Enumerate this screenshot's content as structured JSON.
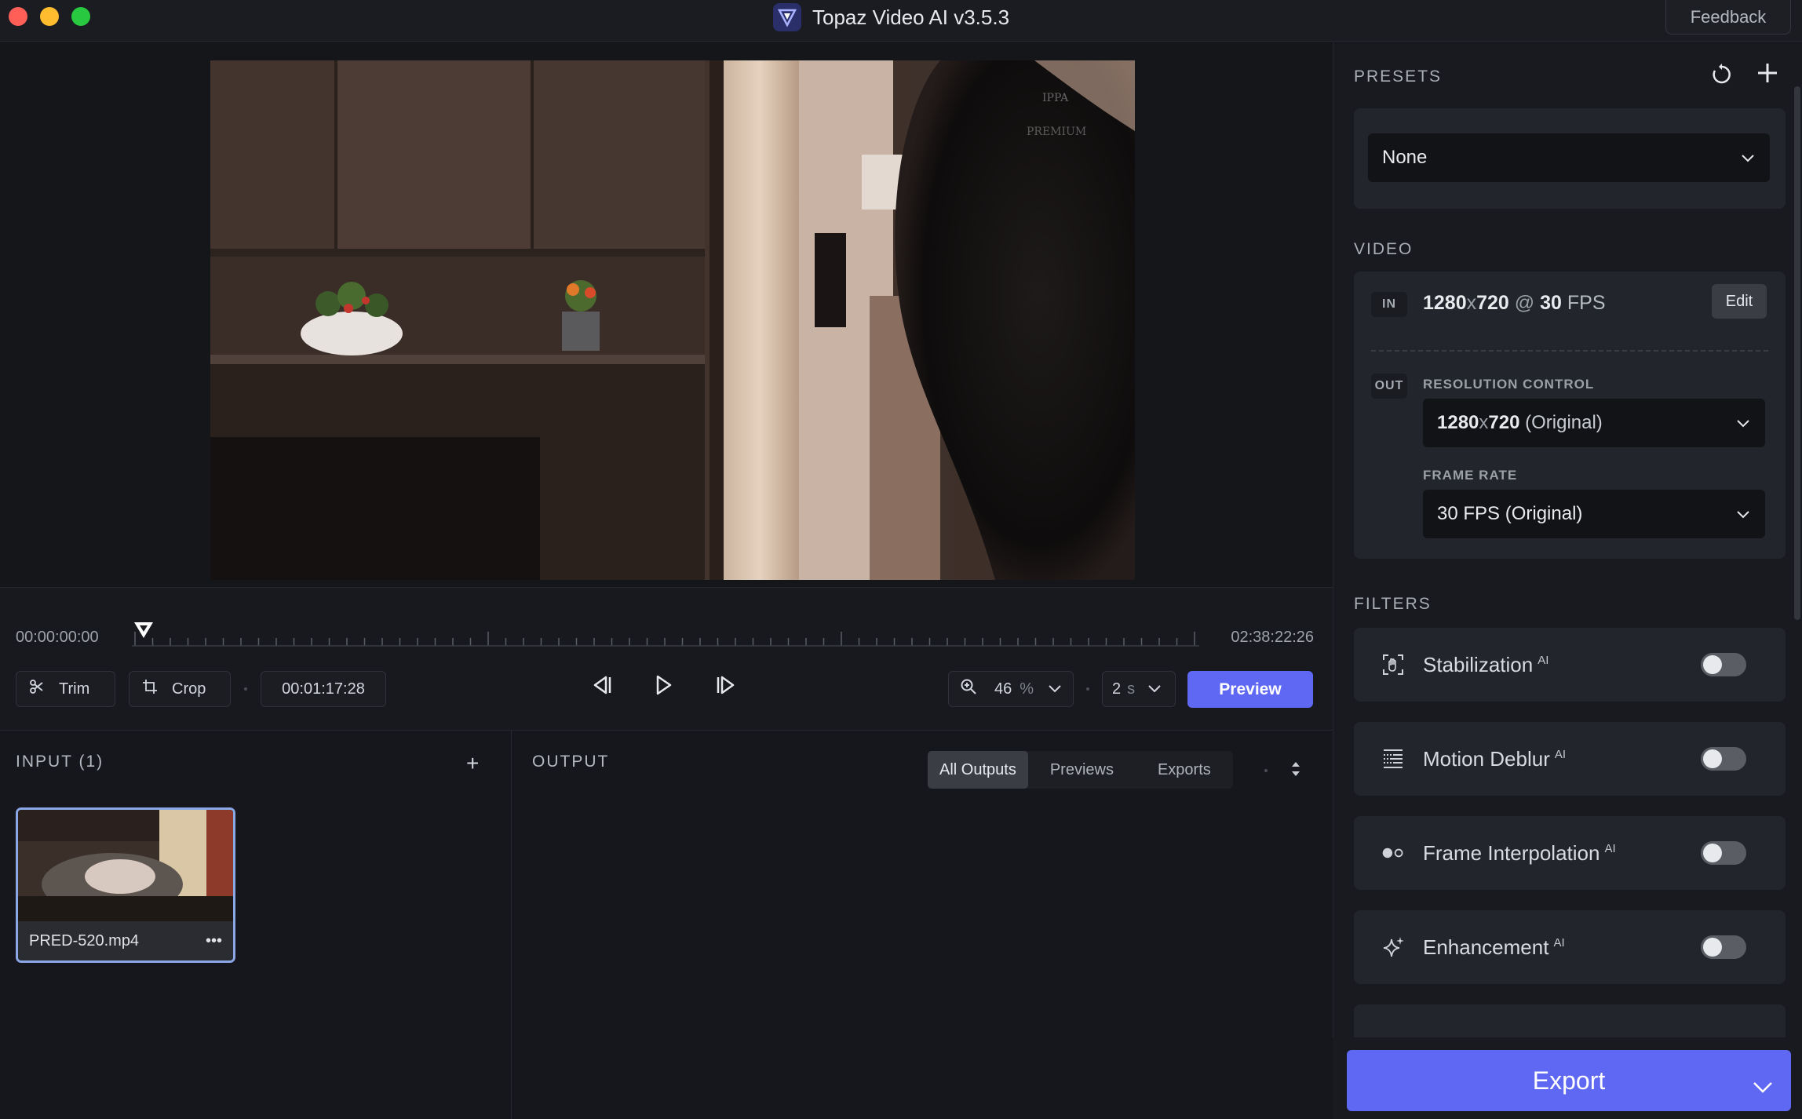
{
  "window": {
    "title": "Topaz Video AI  v3.5.3",
    "feedback_label": "Feedback"
  },
  "timeline": {
    "start_tc": "00:00:00:00",
    "end_tc": "02:38:22:26",
    "current_tc": "00:01:17:28",
    "trim_label": "Trim",
    "crop_label": "Crop",
    "zoom_value": "46",
    "zoom_unit": "%",
    "interval_value": "2",
    "interval_unit": "s",
    "preview_label": "Preview"
  },
  "input": {
    "title": "INPUT (1)",
    "add_label": "+",
    "files": [
      {
        "name": "PRED-520.mp4",
        "menu": "•••"
      }
    ]
  },
  "output": {
    "title": "OUTPUT",
    "tabs": [
      "All Outputs",
      "Previews",
      "Exports"
    ],
    "active_tab": "All Outputs"
  },
  "presets": {
    "heading": "PRESETS",
    "selected": "None"
  },
  "video": {
    "heading": "VIDEO",
    "in_tag": "IN",
    "in_res": "1280",
    "in_x": "x",
    "in_res2": "720",
    "in_at": "@",
    "in_fps": "30",
    "in_fps_unit": "FPS",
    "edit_label": "Edit",
    "out_tag": "OUT",
    "resolution_label": "RESOLUTION CONTROL",
    "resolution_main": "1280",
    "resolution_x": "x",
    "resolution_main2": "720",
    "resolution_note": "(Original)",
    "frame_rate_label": "FRAME RATE",
    "frame_rate_value": "30 FPS (Original)"
  },
  "filters": {
    "heading": "FILTERS",
    "items": [
      {
        "label": "Stabilization",
        "badge": "AI",
        "enabled": false
      },
      {
        "label": "Motion Deblur",
        "badge": "AI",
        "enabled": false
      },
      {
        "label": "Frame Interpolation",
        "badge": "AI",
        "enabled": false
      },
      {
        "label": "Enhancement",
        "badge": "AI",
        "enabled": false
      }
    ]
  },
  "export": {
    "label": "Export"
  },
  "colors": {
    "accent": "#5f68f2",
    "bg": "#15171c",
    "panel": "#22252b"
  }
}
